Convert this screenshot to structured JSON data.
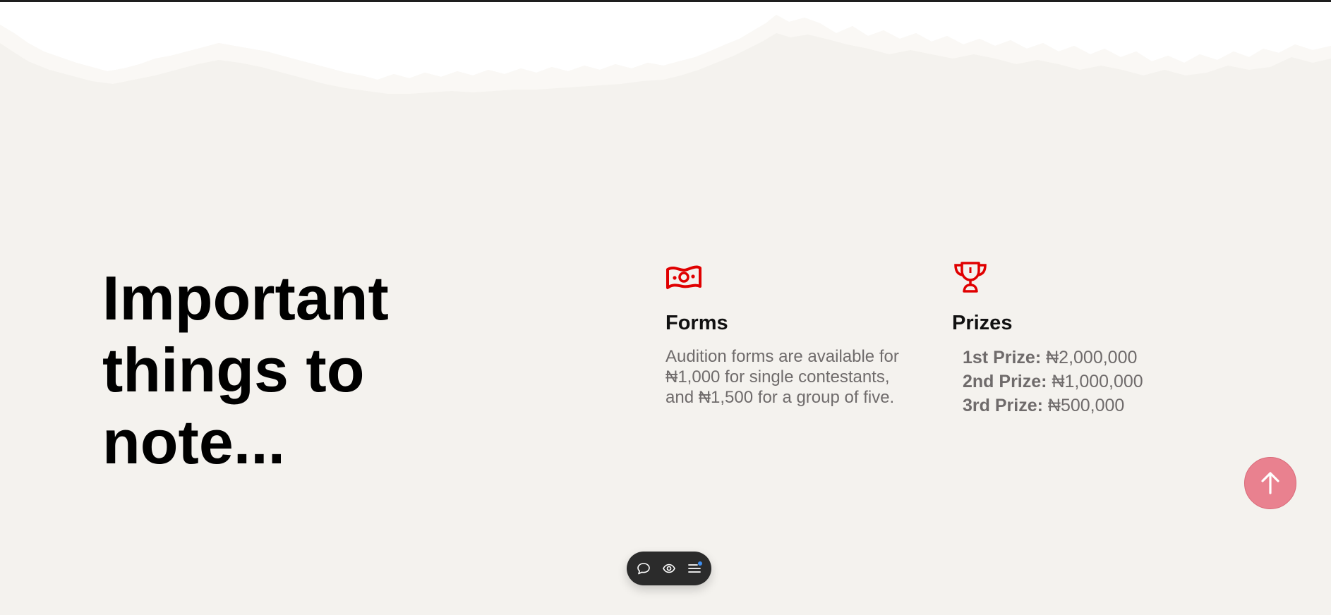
{
  "section": {
    "heading": "Important things to note..."
  },
  "features": {
    "forms": {
      "icon": "money-bill-icon",
      "title": "Forms",
      "description": "Audition forms are available for ₦1,000 for single contestants, and ₦1,500 for a group of five."
    },
    "prizes": {
      "icon": "trophy-icon",
      "title": "Prizes",
      "items": [
        {
          "label": "1st Prize:",
          "amount": "₦2,000,000"
        },
        {
          "label": "2nd Prize:",
          "amount": "₦1,000,000"
        },
        {
          "label": "3rd Prize:",
          "amount": "₦500,000"
        }
      ]
    }
  },
  "scroll_top": {
    "icon": "arrow-up-icon"
  },
  "toolbar": {
    "buttons": [
      "comment-icon",
      "eye-icon",
      "menu-list-icon"
    ]
  },
  "colors": {
    "background": "#f4f2ee",
    "accent_red": "#e00000",
    "scroll_button": "#e9818f",
    "toolbar": "#2b2b2b",
    "notification_dot": "#3d8ef0"
  }
}
